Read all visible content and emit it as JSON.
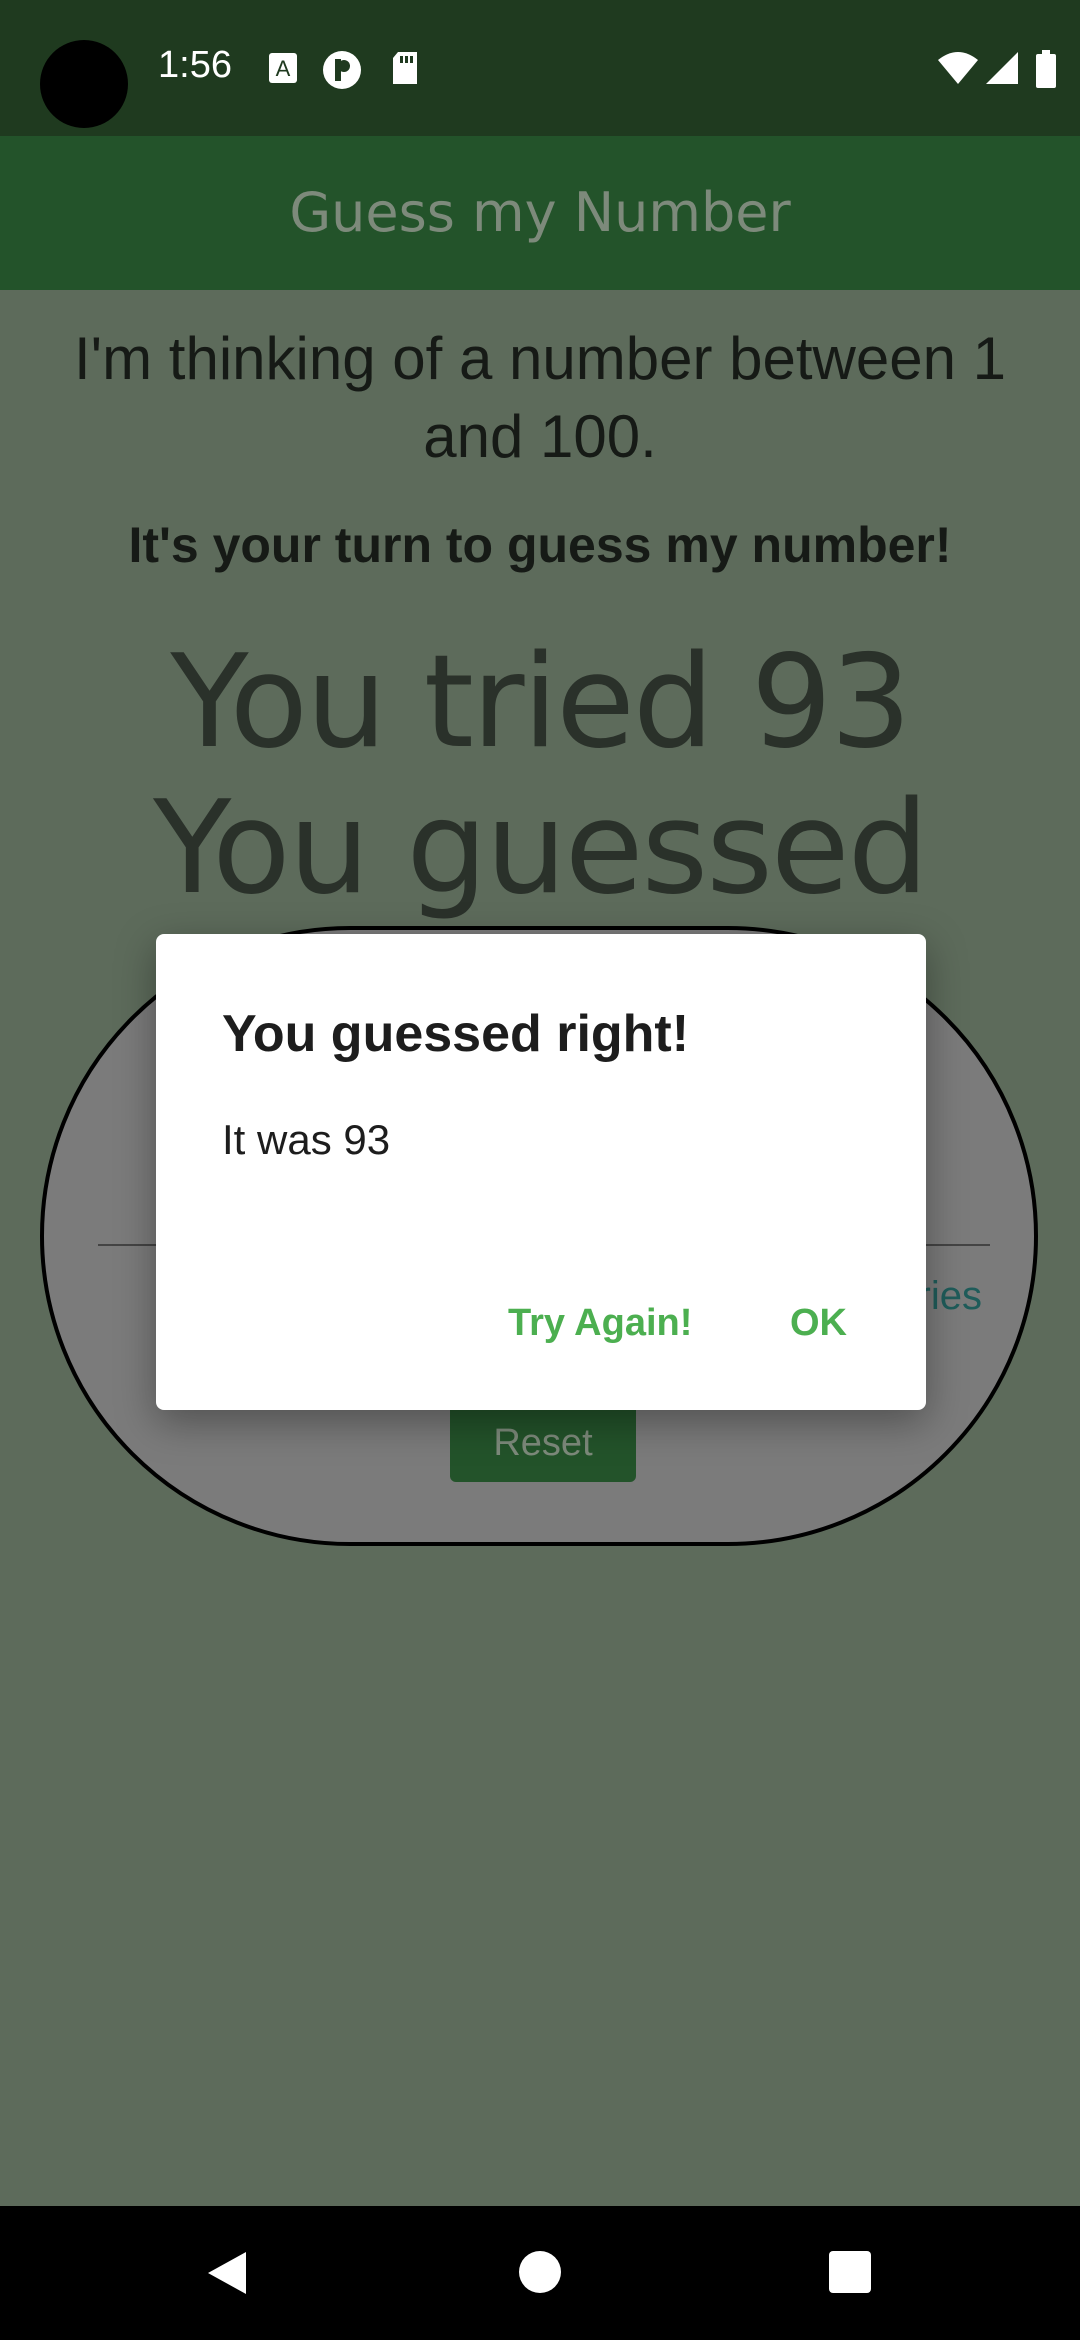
{
  "status": {
    "time": "1:56",
    "icons": [
      "a-badge-icon",
      "circle-p-icon",
      "sd-card-icon",
      "wifi-icon",
      "signal-icon",
      "battery-icon"
    ]
  },
  "appbar": {
    "title": "Guess my Number"
  },
  "main": {
    "intro": "I'm thinking of a number between 1 and 100.",
    "turn": "It's your turn to guess my number!",
    "tried": "You tried 93",
    "result": "You guessed right!",
    "tries_label": "ries",
    "reset_label": "Reset"
  },
  "dialog": {
    "title": "You guessed right!",
    "message": "It was 93",
    "try_again_label": "Try Again!",
    "ok_label": "OK"
  },
  "navbar": {
    "buttons": [
      "back-icon",
      "home-icon",
      "recents-icon"
    ]
  },
  "colors": {
    "accent": "#4caf50",
    "appbar": "#23532a",
    "scrim": "#5d6b5b"
  }
}
